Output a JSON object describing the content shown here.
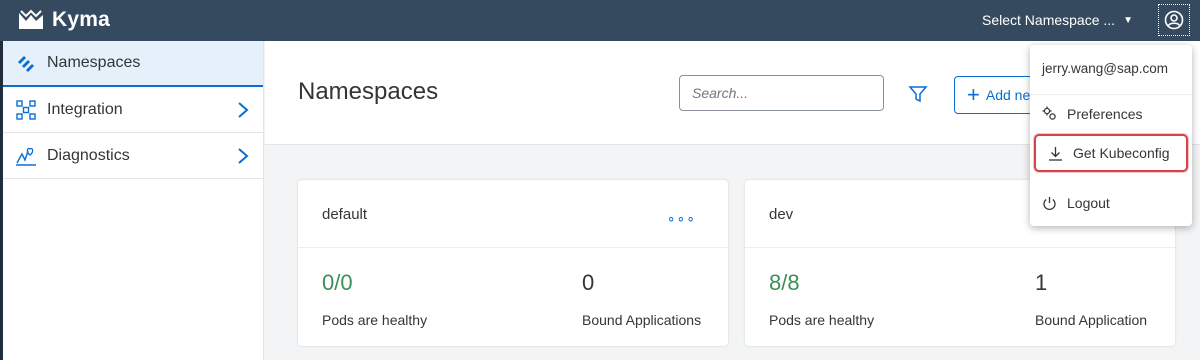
{
  "shell": {
    "app_name": "Kyma",
    "namespace_select": "Select Namespace ..."
  },
  "sidebar": {
    "items": [
      {
        "label": "Namespaces",
        "icon": "namespaces-icon"
      },
      {
        "label": "Integration",
        "icon": "integration-icon"
      },
      {
        "label": "Diagnostics",
        "icon": "diagnostics-icon"
      }
    ]
  },
  "main": {
    "title": "Namespaces",
    "search_placeholder": "Search...",
    "add_label": "Add new namespace"
  },
  "cards": [
    {
      "name": "default",
      "more": "∘∘∘",
      "pods_value": "0/0",
      "pods_label": "Pods are healthy",
      "apps_value": "0",
      "apps_label": "Bound Applications"
    },
    {
      "name": "dev",
      "pods_value": "8/8",
      "pods_label": "Pods are healthy",
      "apps_value": "1",
      "apps_label": "Bound Application"
    }
  ],
  "user_menu": {
    "email": "jerry.wang@sap.com",
    "items": [
      {
        "label": "Preferences",
        "icon": "preferences-icon"
      },
      {
        "label": "Get Kubeconfig",
        "icon": "download-icon"
      },
      {
        "label": "Logout",
        "icon": "power-icon"
      }
    ]
  },
  "colors": {
    "shell": "#354a5f",
    "accent": "#0a6ed1",
    "healthy": "#3d8f58",
    "highlight": "#d4444a"
  }
}
